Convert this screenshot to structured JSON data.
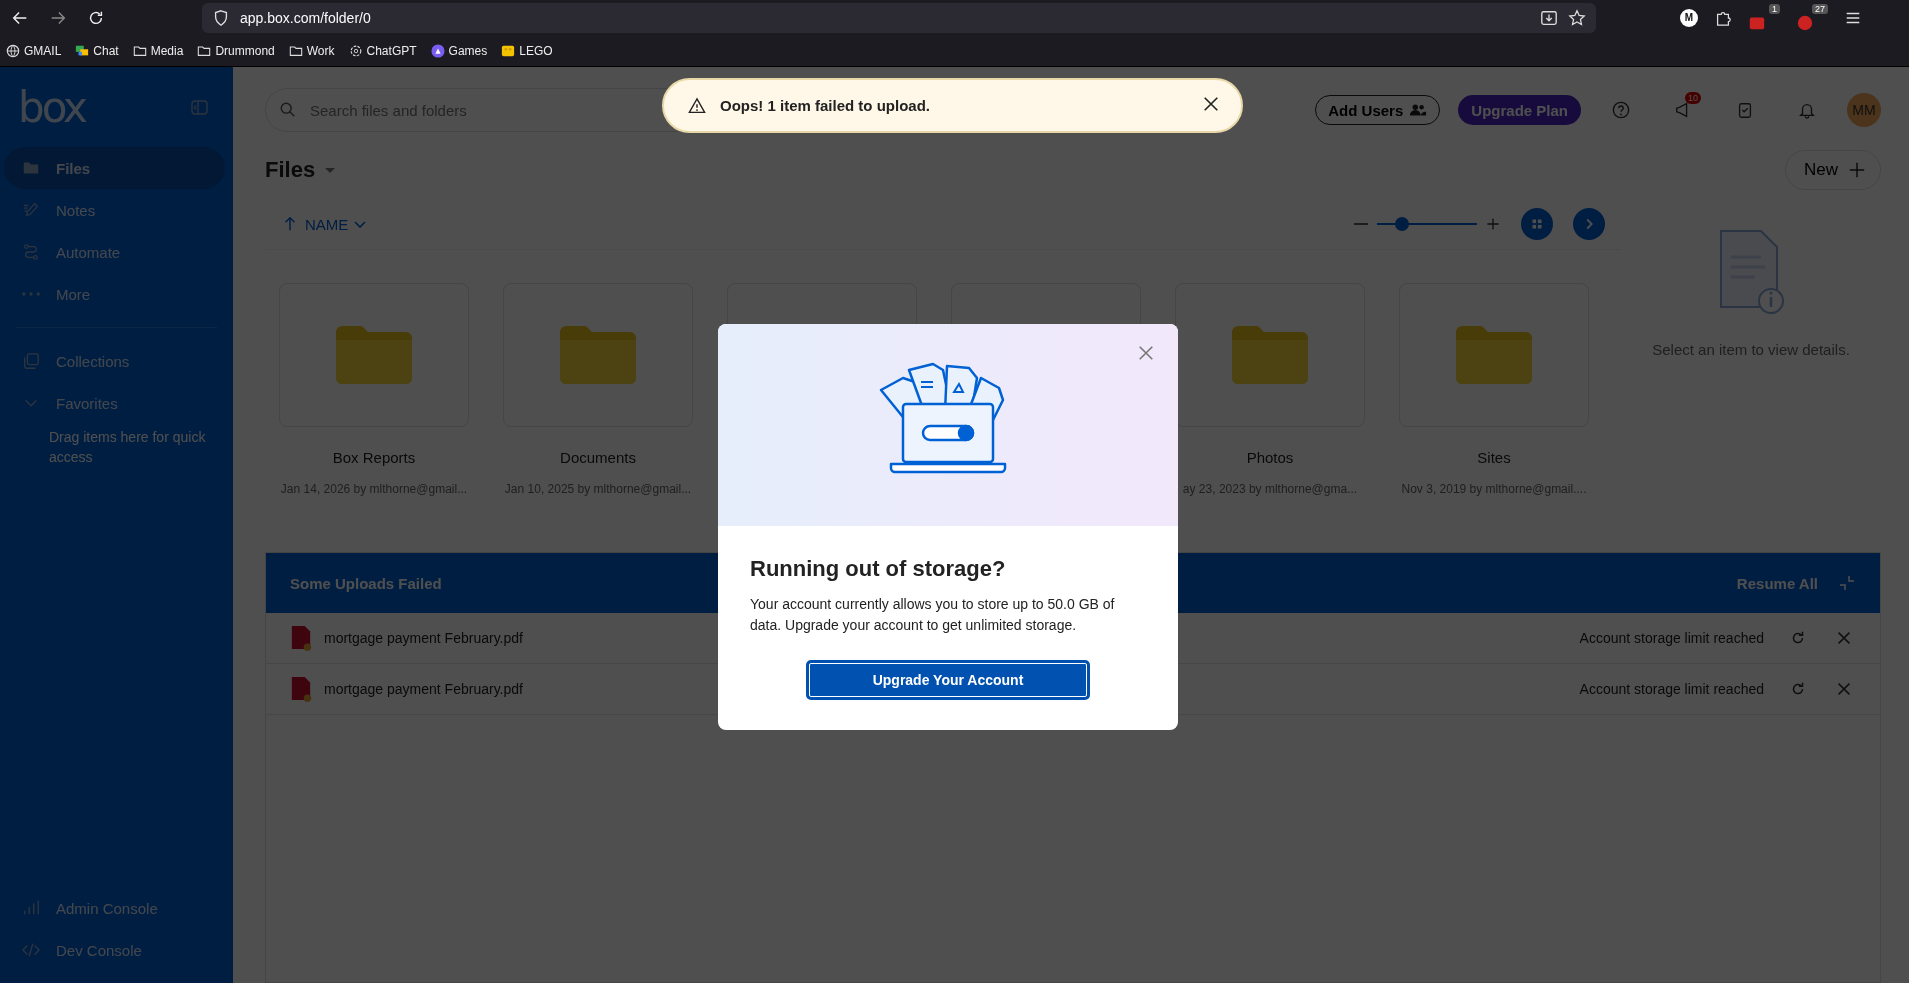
{
  "browser": {
    "url": "app.box.com/folder/0",
    "extension_badges": [
      "1",
      "27"
    ],
    "profile": "M",
    "bookmarks": [
      {
        "label": "GMAIL",
        "kind": "globe"
      },
      {
        "label": "Chat",
        "kind": "chat"
      },
      {
        "label": "Media",
        "kind": "folder"
      },
      {
        "label": "Drummond",
        "kind": "folder"
      },
      {
        "label": "Work",
        "kind": "folder"
      },
      {
        "label": "ChatGPT",
        "kind": "gpt"
      },
      {
        "label": "Games",
        "kind": "games"
      },
      {
        "label": "LEGO",
        "kind": "lego"
      }
    ]
  },
  "sidebar": {
    "logo": "box",
    "items": [
      {
        "label": "Files",
        "kind": "folder",
        "selected": true
      },
      {
        "label": "Notes",
        "kind": "notes",
        "selected": false
      },
      {
        "label": "Automate",
        "kind": "automate",
        "selected": false
      },
      {
        "label": "More",
        "kind": "more",
        "selected": false
      }
    ],
    "collections": "Collections",
    "favorites": {
      "label": "Favorites",
      "expanded": true,
      "hint": "Drag items here for quick access"
    },
    "bottom": [
      {
        "label": "Admin Console",
        "kind": "chart"
      },
      {
        "label": "Dev Console",
        "kind": "code"
      }
    ]
  },
  "header": {
    "search": {
      "placeholder": "Search files and folders"
    },
    "add_users": "Add Users",
    "upgrade": "Upgrade Plan",
    "notification_count": "10",
    "avatar": "MM"
  },
  "toast": {
    "message": "Oops! 1 item failed to upload."
  },
  "files": {
    "title": "Files",
    "new": "New",
    "sort": "NAME",
    "zoom": {
      "level": 0.25
    },
    "folders": [
      {
        "kind": "folder",
        "name": "Box Reports",
        "meta": "Jan 14, 2026 by mlthorne@gmail..."
      },
      {
        "kind": "folder",
        "name": "Documents",
        "meta": "Jan 10, 2025 by mlthorne@gmail..."
      },
      {
        "kind": "card"
      },
      {
        "kind": "card"
      },
      {
        "kind": "folder",
        "name": "Photos",
        "meta": "ay 23, 2023 by mlthorne@gma..."
      },
      {
        "kind": "folder",
        "name": "Sites",
        "meta": "Nov 3, 2019 by mlthorne@gmail...."
      }
    ],
    "details": "Select an item to view details."
  },
  "uploads": {
    "title": "Some Uploads Failed",
    "resume": "Resume All",
    "rows": [
      {
        "name": "mortgage payment February.pdf",
        "status": "Account storage limit reached"
      },
      {
        "name": "mortgage payment February.pdf",
        "status": "Account storage limit reached"
      }
    ]
  },
  "modal": {
    "title": "Running out of storage?",
    "body": "Your account currently allows you to store up to 50.0 GB of data. Upgrade your account to get unlimited storage.",
    "button": "Upgrade Your Account"
  }
}
